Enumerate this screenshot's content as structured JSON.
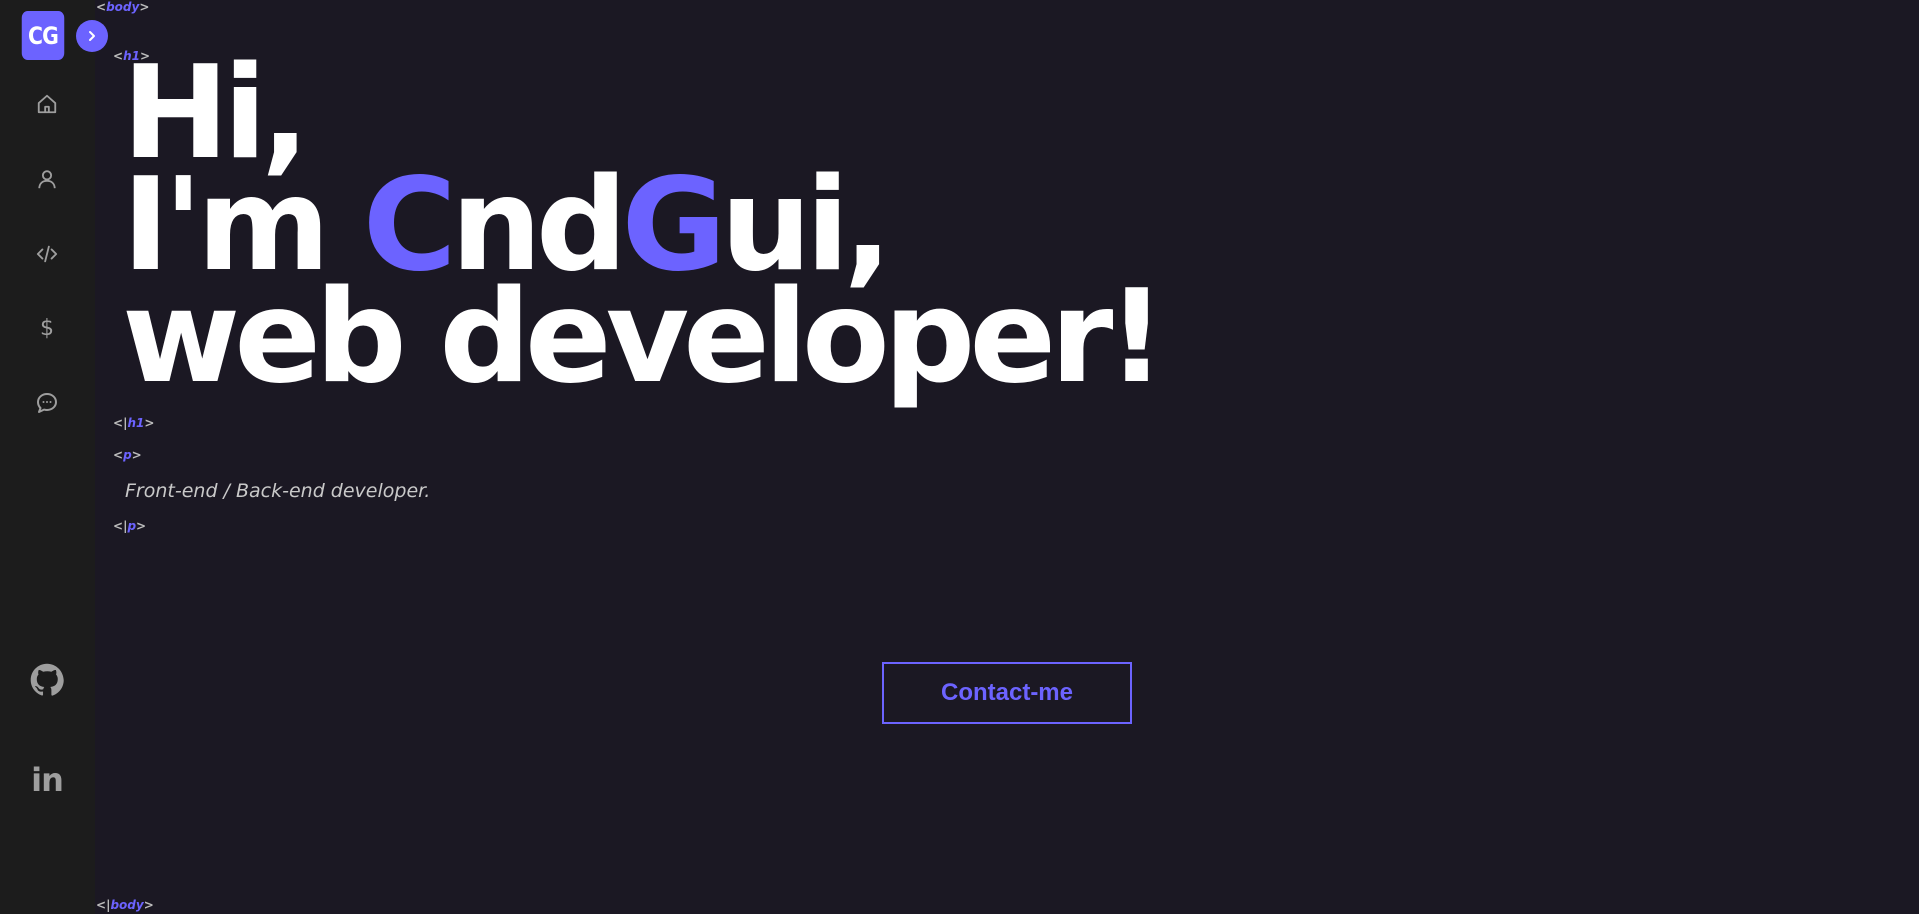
{
  "logo": {
    "text": "CG"
  },
  "sidebar": {
    "items": [
      {
        "name": "home",
        "icon": "home-icon"
      },
      {
        "name": "about",
        "icon": "user-icon"
      },
      {
        "name": "projects",
        "icon": "code-icon"
      },
      {
        "name": "pricing",
        "icon": "dollar-icon",
        "glyph": "$"
      },
      {
        "name": "contact",
        "icon": "chat-icon"
      }
    ],
    "social": [
      {
        "name": "github",
        "icon": "github-icon"
      },
      {
        "name": "linkedin",
        "icon": "linkedin-icon",
        "glyph": "in"
      }
    ]
  },
  "tags": {
    "body_open": "body",
    "body_close": "body",
    "h1_open": "h1",
    "h1_close": "h1",
    "p_open": "p",
    "p_close": "p"
  },
  "hero": {
    "line1": "Hi,",
    "line2_prefix": "I'm ",
    "line2_accent1": "C",
    "line2_mid": "nd",
    "line2_accent2": "G",
    "line2_suffix": "ui,",
    "line3": "web developer!"
  },
  "subtitle": "Front-end / Back-end developer.",
  "cta": {
    "label": "Contact-me"
  },
  "colors": {
    "background": "#1b1823",
    "sidebar": "#1c1c1c",
    "accent": "#6c63ff",
    "text": "#ffffff",
    "icon": "#9e9e9e"
  }
}
